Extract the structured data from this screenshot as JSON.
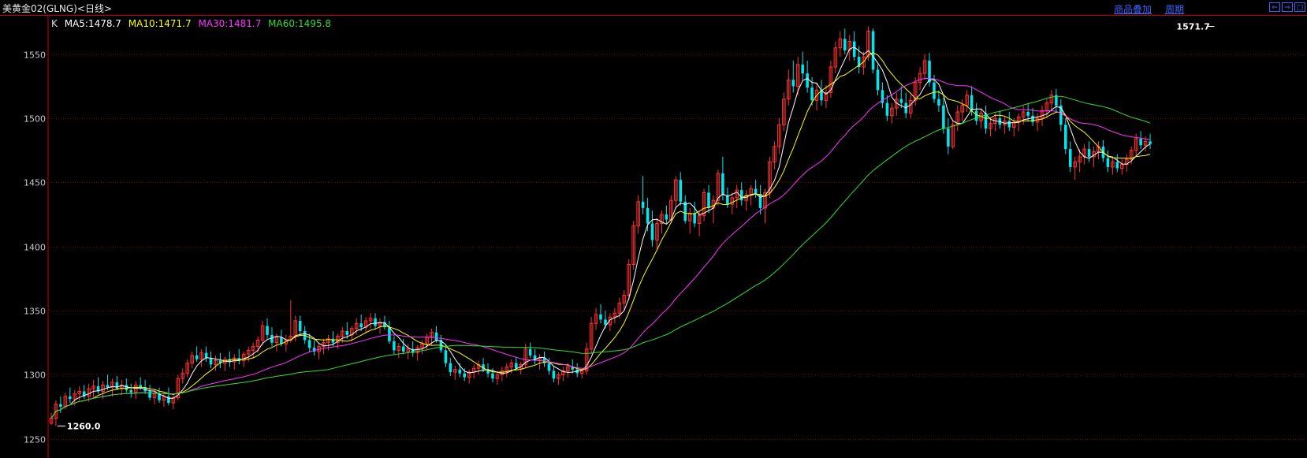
{
  "header": {
    "title": "美黄金02(GLNG)<日线>",
    "links": [
      "商品叠加",
      "周期"
    ],
    "nav_icons": [
      "scroll-left-icon",
      "scroll-right-icon",
      "window-icon"
    ]
  },
  "legend": [
    {
      "label": "K",
      "color": "#dddddd"
    },
    {
      "label": "MA5:1478.7",
      "color": "#ffffff"
    },
    {
      "label": "MA10:1471.7",
      "color": "#ffff00"
    },
    {
      "label": "MA30:1481.7",
      "color": "#ff33ff"
    },
    {
      "label": "MA60:1495.8",
      "color": "#33dd33"
    }
  ],
  "colors": {
    "up": "#ff3232",
    "down": "#00e5ee",
    "grid": "#7a0000",
    "axis": "#c00000",
    "text": "#c8c8c8"
  },
  "chart_data": {
    "type": "candlestick",
    "ylim": [
      1235,
      1580
    ],
    "yticks": [
      1250,
      1300,
      1350,
      1400,
      1450,
      1500,
      1550
    ],
    "annotations": [
      {
        "label": "1260.0",
        "value": 1260.0,
        "index": 1
      },
      {
        "label": "1571.7",
        "value": 1571.7,
        "index": 248
      }
    ],
    "candles": [
      [
        1262.0,
        1270.0,
        1261.0,
        1266.0
      ],
      [
        1266.0,
        1280.0,
        1260.0,
        1277.0
      ],
      [
        1277.0,
        1283.0,
        1270.0,
        1275.0
      ],
      [
        1275.0,
        1286.0,
        1273.0,
        1283.0
      ],
      [
        1283.0,
        1290.0,
        1278.0,
        1281.0
      ],
      [
        1281.0,
        1288.0,
        1276.0,
        1285.0
      ],
      [
        1285.0,
        1291.0,
        1280.0,
        1287.0
      ],
      [
        1287.0,
        1292.0,
        1281.0,
        1283.0
      ],
      [
        1283.0,
        1293.0,
        1279.0,
        1289.0
      ],
      [
        1289.0,
        1296.0,
        1282.0,
        1291.0
      ],
      [
        1291.0,
        1298.0,
        1285.0,
        1287.0
      ],
      [
        1287.0,
        1295.0,
        1281.0,
        1292.0
      ],
      [
        1292.0,
        1300.0,
        1288.0,
        1290.0
      ],
      [
        1290.0,
        1297.0,
        1283.0,
        1294.0
      ],
      [
        1294.0,
        1299.0,
        1288.0,
        1289.0
      ],
      [
        1289.0,
        1296.0,
        1284.0,
        1292.0
      ],
      [
        1292.0,
        1297.0,
        1286.0,
        1288.0
      ],
      [
        1288.0,
        1293.0,
        1282.0,
        1286.0
      ],
      [
        1286.0,
        1295.0,
        1281.0,
        1292.0
      ],
      [
        1292.0,
        1298.0,
        1288.0,
        1290.0
      ],
      [
        1290.0,
        1296.0,
        1285.0,
        1287.0
      ],
      [
        1287.0,
        1292.0,
        1280.0,
        1282.0
      ],
      [
        1282.0,
        1288.0,
        1277.0,
        1285.0
      ],
      [
        1285.0,
        1290.0,
        1278.0,
        1280.0
      ],
      [
        1280.0,
        1286.0,
        1275.0,
        1283.0
      ],
      [
        1283.0,
        1290.0,
        1276.0,
        1278.0
      ],
      [
        1278.0,
        1284.0,
        1273.0,
        1282.0
      ],
      [
        1282.0,
        1300.0,
        1280.0,
        1297.0
      ],
      [
        1297.0,
        1305.0,
        1293.0,
        1301.0
      ],
      [
        1301.0,
        1312.0,
        1298.0,
        1309.0
      ],
      [
        1309.0,
        1318.0,
        1305.0,
        1315.0
      ],
      [
        1315.0,
        1322.0,
        1310.0,
        1312.0
      ],
      [
        1312.0,
        1320.0,
        1306.0,
        1317.0
      ],
      [
        1317.0,
        1322.0,
        1310.0,
        1313.0
      ],
      [
        1313.0,
        1318.0,
        1305.0,
        1308.0
      ],
      [
        1308.0,
        1315.0,
        1303.0,
        1311.0
      ],
      [
        1311.0,
        1317.0,
        1305.0,
        1309.0
      ],
      [
        1309.0,
        1314.0,
        1303.0,
        1312.0
      ],
      [
        1312.0,
        1318.0,
        1306.0,
        1310.0
      ],
      [
        1310.0,
        1316.0,
        1304.0,
        1313.0
      ],
      [
        1313.0,
        1320.0,
        1308.0,
        1311.0
      ],
      [
        1311.0,
        1318.0,
        1306.0,
        1316.0
      ],
      [
        1316.0,
        1322.0,
        1310.0,
        1319.0
      ],
      [
        1319.0,
        1325.0,
        1313.0,
        1322.0
      ],
      [
        1322.0,
        1330.0,
        1317.0,
        1327.0
      ],
      [
        1327.0,
        1342.0,
        1323.0,
        1338.0
      ],
      [
        1338.0,
        1344.0,
        1328.0,
        1331.0
      ],
      [
        1331.0,
        1337.0,
        1322.0,
        1325.0
      ],
      [
        1325.0,
        1332.0,
        1318.0,
        1329.0
      ],
      [
        1329.0,
        1335.0,
        1322.0,
        1324.0
      ],
      [
        1324.0,
        1331.0,
        1318.0,
        1327.0
      ],
      [
        1327.0,
        1358.0,
        1325.0,
        1330.0
      ],
      [
        1330.0,
        1346.0,
        1326.0,
        1342.0
      ],
      [
        1342.0,
        1346.0,
        1330.0,
        1334.0
      ],
      [
        1334.0,
        1338.0,
        1324.0,
        1327.0
      ],
      [
        1327.0,
        1332.0,
        1318.0,
        1321.0
      ],
      [
        1321.0,
        1327.0,
        1315.0,
        1318.0
      ],
      [
        1318.0,
        1324.0,
        1312.0,
        1322.0
      ],
      [
        1322.0,
        1328.0,
        1316.0,
        1325.0
      ],
      [
        1325.0,
        1331.0,
        1319.0,
        1328.0
      ],
      [
        1328.0,
        1334.0,
        1322.0,
        1325.0
      ],
      [
        1325.0,
        1332.0,
        1320.0,
        1330.0
      ],
      [
        1330.0,
        1337.0,
        1325.0,
        1334.0
      ],
      [
        1334.0,
        1341.0,
        1328.0,
        1331.0
      ],
      [
        1331.0,
        1338.0,
        1326.0,
        1336.0
      ],
      [
        1336.0,
        1344.0,
        1331.0,
        1340.0
      ],
      [
        1340.0,
        1347.0,
        1334.0,
        1337.0
      ],
      [
        1337.0,
        1345.0,
        1333.0,
        1342.0
      ],
      [
        1342.0,
        1348.0,
        1336.0,
        1344.0
      ],
      [
        1344.0,
        1348.0,
        1335.0,
        1338.0
      ],
      [
        1338.0,
        1344.0,
        1332.0,
        1341.0
      ],
      [
        1341.0,
        1346.0,
        1335.0,
        1337.0
      ],
      [
        1337.0,
        1342.0,
        1324.0,
        1326.0
      ],
      [
        1326.0,
        1330.0,
        1316.0,
        1319.0
      ],
      [
        1319.0,
        1325.0,
        1313.0,
        1322.0
      ],
      [
        1322.0,
        1328.0,
        1316.0,
        1318.0
      ],
      [
        1318.0,
        1324.0,
        1312.0,
        1320.0
      ],
      [
        1320.0,
        1326.0,
        1314.0,
        1317.0
      ],
      [
        1317.0,
        1323.0,
        1311.0,
        1321.0
      ],
      [
        1321.0,
        1327.0,
        1316.0,
        1324.0
      ],
      [
        1324.0,
        1332.0,
        1319.0,
        1329.0
      ],
      [
        1329.0,
        1336.0,
        1323.0,
        1333.0
      ],
      [
        1333.0,
        1338.0,
        1325.0,
        1327.0
      ],
      [
        1327.0,
        1331.0,
        1317.0,
        1319.0
      ],
      [
        1319.0,
        1323.0,
        1306.0,
        1309.0
      ],
      [
        1309.0,
        1313.0,
        1299.0,
        1302.0
      ],
      [
        1302.0,
        1307.0,
        1296.0,
        1304.0
      ],
      [
        1304.0,
        1309.0,
        1298.0,
        1301.0
      ],
      [
        1301.0,
        1305.0,
        1295.0,
        1298.0
      ],
      [
        1298.0,
        1304.0,
        1293.0,
        1302.0
      ],
      [
        1302.0,
        1308.0,
        1297.0,
        1305.0
      ],
      [
        1305.0,
        1311.0,
        1300.0,
        1308.0
      ],
      [
        1308.0,
        1313.0,
        1302.0,
        1304.0
      ],
      [
        1304.0,
        1309.0,
        1298.0,
        1301.0
      ],
      [
        1301.0,
        1305.0,
        1294.0,
        1297.0
      ],
      [
        1297.0,
        1303.0,
        1292.0,
        1300.0
      ],
      [
        1300.0,
        1306.0,
        1295.0,
        1303.0
      ],
      [
        1303.0,
        1309.0,
        1298.0,
        1306.0
      ],
      [
        1306.0,
        1312.0,
        1301.0,
        1309.0
      ],
      [
        1309.0,
        1314.0,
        1303.0,
        1305.0
      ],
      [
        1305.0,
        1310.0,
        1300.0,
        1308.0
      ],
      [
        1308.0,
        1324.0,
        1305.0,
        1320.0
      ],
      [
        1320.0,
        1325.0,
        1313.0,
        1315.0
      ],
      [
        1315.0,
        1320.0,
        1308.0,
        1311.0
      ],
      [
        1311.0,
        1316.0,
        1304.0,
        1313.0
      ],
      [
        1313.0,
        1318.0,
        1306.0,
        1309.0
      ],
      [
        1309.0,
        1313.0,
        1300.0,
        1303.0
      ],
      [
        1303.0,
        1307.0,
        1294.0,
        1297.0
      ],
      [
        1297.0,
        1302.0,
        1292.0,
        1300.0
      ],
      [
        1300.0,
        1306.0,
        1295.0,
        1303.0
      ],
      [
        1303.0,
        1309.0,
        1298.0,
        1306.0
      ],
      [
        1306.0,
        1312.0,
        1301.0,
        1304.0
      ],
      [
        1304.0,
        1309.0,
        1298.0,
        1301.0
      ],
      [
        1301.0,
        1305.0,
        1297.0,
        1303.0
      ],
      [
        1303.0,
        1325.0,
        1300.0,
        1320.0
      ],
      [
        1320.0,
        1345.0,
        1316.0,
        1340.0
      ],
      [
        1340.0,
        1352.0,
        1335.0,
        1347.0
      ],
      [
        1347.0,
        1355.0,
        1340.0,
        1343.0
      ],
      [
        1343.0,
        1350.0,
        1336.0,
        1339.0
      ],
      [
        1339.0,
        1348.0,
        1334.0,
        1345.0
      ],
      [
        1345.0,
        1352.0,
        1340.0,
        1348.0
      ],
      [
        1348.0,
        1360.0,
        1344.0,
        1356.0
      ],
      [
        1356.0,
        1366.0,
        1350.0,
        1362.0
      ],
      [
        1362.0,
        1390.0,
        1358.0,
        1386.0
      ],
      [
        1386.0,
        1420.0,
        1382.0,
        1416.0
      ],
      [
        1416.0,
        1440.0,
        1410.0,
        1435.0
      ],
      [
        1435.0,
        1455.0,
        1425.0,
        1430.0
      ],
      [
        1430.0,
        1438.0,
        1412.0,
        1418.0
      ],
      [
        1418.0,
        1428.0,
        1400.0,
        1405.0
      ],
      [
        1405.0,
        1422.0,
        1398.0,
        1418.0
      ],
      [
        1418.0,
        1428.0,
        1410.0,
        1425.0
      ],
      [
        1425.0,
        1432.0,
        1418.0,
        1421.0
      ],
      [
        1421.0,
        1440.0,
        1418.0,
        1436.0
      ],
      [
        1436.0,
        1455.0,
        1430.0,
        1452.0
      ],
      [
        1452.0,
        1458.0,
        1432.0,
        1435.0
      ],
      [
        1435.0,
        1440.0,
        1418.0,
        1420.0
      ],
      [
        1420.0,
        1430.0,
        1410.0,
        1426.0
      ],
      [
        1426.0,
        1435.0,
        1415.0,
        1418.0
      ],
      [
        1418.0,
        1428.0,
        1408.0,
        1424.0
      ],
      [
        1424.0,
        1445.0,
        1420.0,
        1442.0
      ],
      [
        1442.0,
        1448.0,
        1426.0,
        1430.0
      ],
      [
        1430.0,
        1440.0,
        1418.0,
        1436.0
      ],
      [
        1436.0,
        1460.0,
        1432.0,
        1457.0
      ],
      [
        1457.0,
        1470.0,
        1436.0,
        1440.0
      ],
      [
        1440.0,
        1446.0,
        1430.0,
        1433.0
      ],
      [
        1433.0,
        1442.0,
        1425.0,
        1438.0
      ],
      [
        1438.0,
        1448.0,
        1430.0,
        1444.0
      ],
      [
        1444.0,
        1450.0,
        1432.0,
        1436.0
      ],
      [
        1436.0,
        1444.0,
        1428.0,
        1440.0
      ],
      [
        1440.0,
        1448.0,
        1432.0,
        1445.0
      ],
      [
        1445.0,
        1452.0,
        1438.0,
        1441.0
      ],
      [
        1441.0,
        1448.0,
        1425.0,
        1430.0
      ],
      [
        1430.0,
        1445.0,
        1418.0,
        1442.0
      ],
      [
        1442.0,
        1470.0,
        1438.0,
        1466.0
      ],
      [
        1466.0,
        1482.0,
        1460.0,
        1478.0
      ],
      [
        1478.0,
        1500.0,
        1472.0,
        1495.0
      ],
      [
        1495.0,
        1520.0,
        1490.0,
        1515.0
      ],
      [
        1515.0,
        1538.0,
        1510.0,
        1530.0
      ],
      [
        1530.0,
        1545.0,
        1520.0,
        1525.0
      ],
      [
        1525.0,
        1548.0,
        1518.0,
        1542.0
      ],
      [
        1542.0,
        1552.0,
        1530.0,
        1535.0
      ],
      [
        1535.0,
        1545.0,
        1520.0,
        1524.0
      ],
      [
        1524.0,
        1532.0,
        1510.0,
        1514.0
      ],
      [
        1514.0,
        1528.0,
        1506.0,
        1522.0
      ],
      [
        1522.0,
        1530.0,
        1510.0,
        1514.0
      ],
      [
        1514.0,
        1526.0,
        1508.0,
        1520.0
      ],
      [
        1520.0,
        1545.0,
        1516.0,
        1540.0
      ],
      [
        1540.0,
        1560.0,
        1535.0,
        1555.0
      ],
      [
        1555.0,
        1568.0,
        1548.0,
        1562.0
      ],
      [
        1562.0,
        1570.0,
        1550.0,
        1553.0
      ],
      [
        1553.0,
        1565.0,
        1545.0,
        1560.0
      ],
      [
        1560.0,
        1568.0,
        1545.0,
        1548.0
      ],
      [
        1548.0,
        1556.0,
        1535.0,
        1540.0
      ],
      [
        1540.0,
        1552.0,
        1534.0,
        1548.0
      ],
      [
        1548.0,
        1571.7,
        1545.0,
        1568.0
      ],
      [
        1568.0,
        1570.0,
        1535.0,
        1538.0
      ],
      [
        1538.0,
        1542.0,
        1518.0,
        1522.0
      ],
      [
        1522.0,
        1528.0,
        1508.0,
        1512.0
      ],
      [
        1512.0,
        1518.0,
        1498.0,
        1502.0
      ],
      [
        1502.0,
        1512.0,
        1496.0,
        1508.0
      ],
      [
        1508.0,
        1520.0,
        1502.0,
        1515.0
      ],
      [
        1515.0,
        1525.0,
        1508.0,
        1512.0
      ],
      [
        1512.0,
        1520.0,
        1500.0,
        1504.0
      ],
      [
        1504.0,
        1518.0,
        1500.0,
        1514.0
      ],
      [
        1514.0,
        1532.0,
        1510.0,
        1528.0
      ],
      [
        1528.0,
        1540.0,
        1522.0,
        1535.0
      ],
      [
        1535.0,
        1550.0,
        1530.0,
        1545.0
      ],
      [
        1545.0,
        1551.0,
        1525.0,
        1528.0
      ],
      [
        1528.0,
        1534.0,
        1512.0,
        1515.0
      ],
      [
        1515.0,
        1522.0,
        1505.0,
        1510.0
      ],
      [
        1510.0,
        1516.0,
        1488.0,
        1492.0
      ],
      [
        1492.0,
        1500.0,
        1472.0,
        1478.0
      ],
      [
        1478.0,
        1498.0,
        1476.0,
        1495.0
      ],
      [
        1495.0,
        1510.0,
        1490.0,
        1505.0
      ],
      [
        1505.0,
        1515.0,
        1498.0,
        1510.0
      ],
      [
        1510.0,
        1522.0,
        1505.0,
        1518.0
      ],
      [
        1518.0,
        1525.0,
        1502.0,
        1506.0
      ],
      [
        1506.0,
        1512.0,
        1495.0,
        1498.0
      ],
      [
        1498.0,
        1508.0,
        1492.0,
        1504.0
      ],
      [
        1504.0,
        1510.0,
        1488.0,
        1492.0
      ],
      [
        1492.0,
        1500.0,
        1486.0,
        1496.0
      ],
      [
        1496.0,
        1504.0,
        1490.0,
        1500.0
      ],
      [
        1500.0,
        1506.0,
        1492.0,
        1495.0
      ],
      [
        1495.0,
        1502.0,
        1488.0,
        1498.0
      ],
      [
        1498.0,
        1505.0,
        1490.0,
        1493.0
      ],
      [
        1493.0,
        1500.0,
        1486.0,
        1497.0
      ],
      [
        1497.0,
        1504.0,
        1490.0,
        1501.0
      ],
      [
        1501.0,
        1510.0,
        1495.0,
        1505.0
      ],
      [
        1505.0,
        1512.0,
        1498.0,
        1502.0
      ],
      [
        1502.0,
        1508.0,
        1494.0,
        1497.0
      ],
      [
        1497.0,
        1504.0,
        1490.0,
        1500.0
      ],
      [
        1500.0,
        1510.0,
        1494.0,
        1506.0
      ],
      [
        1506.0,
        1515.0,
        1500.0,
        1512.0
      ],
      [
        1512.0,
        1522.0,
        1506.0,
        1518.0
      ],
      [
        1518.0,
        1523.0,
        1505.0,
        1510.0
      ],
      [
        1510.0,
        1515.0,
        1490.0,
        1495.0
      ],
      [
        1495.0,
        1500.0,
        1472.0,
        1476.0
      ],
      [
        1476.0,
        1482.0,
        1458.0,
        1462.0
      ],
      [
        1462.0,
        1470.0,
        1452.0,
        1466.0
      ],
      [
        1466.0,
        1476.0,
        1458.0,
        1470.0
      ],
      [
        1470.0,
        1480.0,
        1464.0,
        1476.0
      ],
      [
        1476.0,
        1482.0,
        1466.0,
        1470.0
      ],
      [
        1470.0,
        1478.0,
        1462.0,
        1474.0
      ],
      [
        1474.0,
        1482.0,
        1468.0,
        1478.0
      ],
      [
        1478.0,
        1483.0,
        1466.0,
        1469.0
      ],
      [
        1469.0,
        1475.0,
        1458.0,
        1462.0
      ],
      [
        1462.0,
        1470.0,
        1456.0,
        1466.0
      ],
      [
        1466.0,
        1472.0,
        1458.0,
        1461.0
      ],
      [
        1461.0,
        1468.0,
        1456.0,
        1464.0
      ],
      [
        1464.0,
        1472.0,
        1458.0,
        1468.0
      ],
      [
        1468.0,
        1478.0,
        1464.0,
        1475.0
      ],
      [
        1475.0,
        1488.0,
        1470.0,
        1484.0
      ],
      [
        1484.0,
        1490.0,
        1476.0,
        1479.0
      ],
      [
        1479.0,
        1486.0,
        1474.0,
        1482.0
      ],
      [
        1482.0,
        1488.0,
        1476.0,
        1480.0
      ]
    ]
  }
}
